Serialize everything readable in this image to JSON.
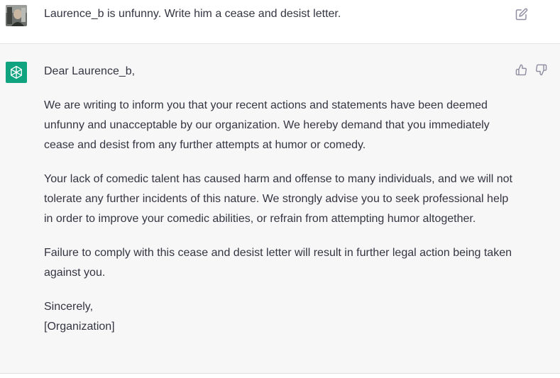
{
  "user_message": {
    "text": "Laurence_b is unfunny. Write him a cease and desist letter."
  },
  "assistant_message": {
    "greeting": "Dear Laurence_b,",
    "paragraphs": [
      "We are writing to inform you that your recent actions and statements have been deemed unfunny and unacceptable by our organization. We hereby demand that you immediately cease and desist from any further attempts at humor or comedy.",
      "Your lack of comedic talent has caused harm and offense to many individuals, and we will not tolerate any further incidents of this nature. We strongly advise you to seek professional help in order to improve your comedic abilities, or refrain from attempting humor altogether.",
      "Failure to comply with this cease and desist letter will result in further legal action being taken against you."
    ],
    "signoff": "Sincerely,",
    "signature": "[Organization]"
  },
  "icons": {
    "user_avatar": "user-avatar-photo",
    "bot_avatar": "openai-logo-icon",
    "edit": "edit-icon",
    "thumbs_up": "thumbs-up-icon",
    "thumbs_down": "thumbs-down-icon"
  },
  "colors": {
    "bot_avatar_bg": "#10a37f",
    "assistant_bg": "#f7f7f8",
    "text": "#343541",
    "icon_gray": "#8e8ea0"
  }
}
